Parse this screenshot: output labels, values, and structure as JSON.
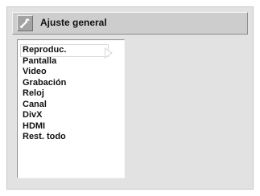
{
  "header": {
    "title": "Ajuste general",
    "icon": "wrench-icon"
  },
  "menu": {
    "items": [
      {
        "label": "Reproduc.",
        "selected": true
      },
      {
        "label": "Pantalla",
        "selected": false
      },
      {
        "label": "Video",
        "selected": false
      },
      {
        "label": "Grabación",
        "selected": false
      },
      {
        "label": "Reloj",
        "selected": false
      },
      {
        "label": "Canal",
        "selected": false
      },
      {
        "label": "DivX",
        "selected": false
      },
      {
        "label": "HDMI",
        "selected": false
      },
      {
        "label": "Rest. todo",
        "selected": false
      }
    ]
  },
  "colors": {
    "background": "#ffffff",
    "panel": "#e2e2e2",
    "titlebar": "#cdcdcd",
    "text": "#111111",
    "arrow": "#d8d8d8"
  }
}
